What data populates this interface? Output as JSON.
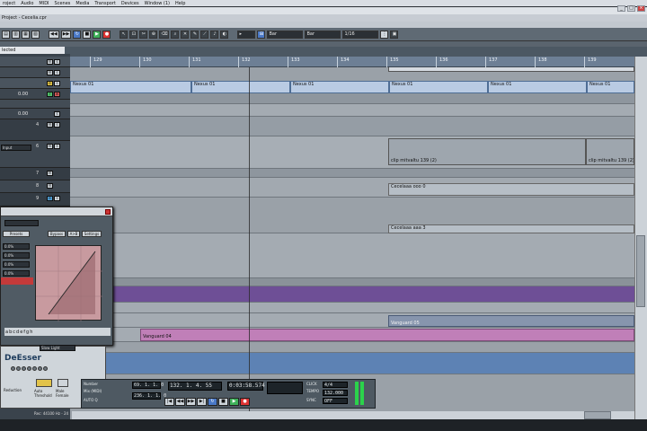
{
  "menu": {
    "items": [
      "roject",
      "Audio",
      "MIDI",
      "Scenes",
      "Media",
      "Transport",
      "Devices",
      "Window (1)",
      "Help"
    ]
  },
  "window": {
    "project_title": "Project - Cecelia.cpr",
    "selected_label": "lected"
  },
  "toolbar": {
    "snap_mode": "Bar",
    "quantize": "1/16",
    "grid": "Bar"
  },
  "ruler": {
    "bars": [
      "129",
      "130",
      "131",
      "132",
      "133",
      "134",
      "135",
      "136",
      "137",
      "138",
      "139"
    ]
  },
  "tracks": {
    "vals": [
      "0.00",
      "0.00"
    ],
    "input_label": "Input",
    "nums": [
      "1",
      "2",
      "3",
      "4",
      "5",
      "6",
      "7",
      "8",
      "9",
      "10"
    ]
  },
  "parts": {
    "nexus_1": "Nexus 01",
    "nexus_2": "Nexus 01",
    "nexus_3": "Nexus 01",
    "nexus_4": "Nexus 01",
    "nexus_5": "Nexus 01",
    "nexus_6": "Nexus 01",
    "clip_a": "clip mitvaltu 139 (2)",
    "clip_b": "clip mitvaltu 139 (2)",
    "cecelia_1": "Cecelaaa ooo 0",
    "cecelia_2": "Cecelaaa aaa 3",
    "vanguard_a": "Vanguard 04",
    "vanguard_b": "Vanguard 05"
  },
  "plugin": {
    "preset_label": "Presets",
    "bypass_label": "Bypass",
    "ab_label": "A>B",
    "settings_label": "Settings",
    "letters": [
      "a",
      "b",
      "c",
      "d",
      "e",
      "f",
      "g",
      "h"
    ],
    "side_vals": [
      "0.0%",
      "0.0%",
      "0.0%",
      "0.0%"
    ]
  },
  "deesser": {
    "title": "DeEsser",
    "preset": "Slow Light",
    "reduction_label": "Reduction",
    "auto_label": "Auto Threshold",
    "male_female": "Male Female",
    "status": "Rec: 44100 Hz - 24"
  },
  "transport": {
    "position": "132. 1. 4. 55",
    "time": "0:03:58.574",
    "left_locator": "69. 1. 1.  0",
    "right_locator": "236. 1. 1.  0",
    "tempo": "132.000",
    "signature": "4/4",
    "click_label": "CLICK",
    "sync_label": "SYNC",
    "offset": "OFF",
    "num_label": "Number",
    "mix_label": "Mix (MIDI)",
    "auto_label": "AUTO Q",
    "tempo_label": "TEMPO",
    "int_label": "INT",
    "track_label": "TRACK"
  },
  "colors": {
    "nexus_part": "#b9cbe3",
    "lane_bg": "#9aa1a8",
    "purple": "#6e4f96",
    "pink": "#c07fb8",
    "ruler": "#6d7f95"
  }
}
